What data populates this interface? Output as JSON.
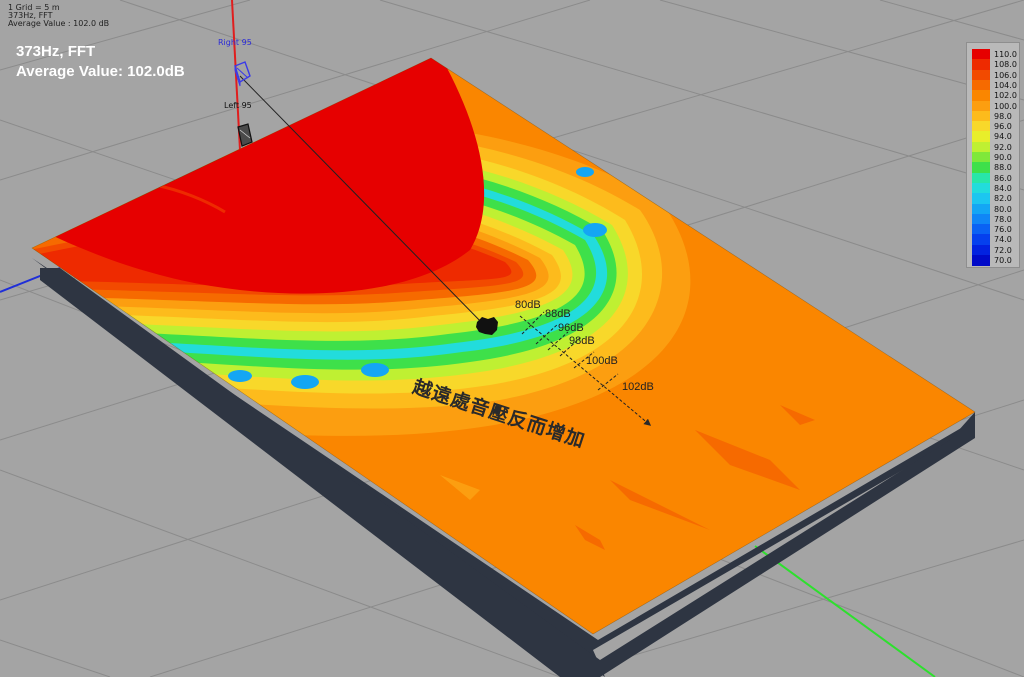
{
  "info": {
    "grid": "1 Grid = 5 m",
    "mode": "373Hz, FFT",
    "avg_small": "Average Value : 102.0 dB"
  },
  "headline": {
    "line1": "373Hz, FFT",
    "line2": "Average Value: 102.0dB"
  },
  "speakers": {
    "right": "Right 95",
    "left": "Left 95"
  },
  "legend": [
    {
      "label": "110.0",
      "color": "#e60000"
    },
    {
      "label": "108.0",
      "color": "#ee2a00"
    },
    {
      "label": "106.0",
      "color": "#f24a00"
    },
    {
      "label": "104.0",
      "color": "#f66a00"
    },
    {
      "label": "102.0",
      "color": "#fa8600"
    },
    {
      "label": "100.0",
      "color": "#fc9e10"
    },
    {
      "label": "98.0",
      "color": "#fdbb1c"
    },
    {
      "label": "96.0",
      "color": "#f8d82a"
    },
    {
      "label": "94.0",
      "color": "#e8ee2a"
    },
    {
      "label": "92.0",
      "color": "#bff032"
    },
    {
      "label": "90.0",
      "color": "#7fe83a"
    },
    {
      "label": "88.0",
      "color": "#3ee04a"
    },
    {
      "label": "86.0",
      "color": "#28e6a8"
    },
    {
      "label": "84.0",
      "color": "#22dcdc"
    },
    {
      "label": "82.0",
      "color": "#1cc6f0"
    },
    {
      "label": "80.0",
      "color": "#14a6f4"
    },
    {
      "label": "78.0",
      "color": "#1086f6"
    },
    {
      "label": "76.0",
      "color": "#0a62f4"
    },
    {
      "label": "74.0",
      "color": "#0540ee"
    },
    {
      "label": "72.0",
      "color": "#0222e0"
    },
    {
      "label": "70.0",
      "color": "#000ac8"
    }
  ],
  "db_marks": [
    "80dB",
    "88dB",
    "96dB",
    "98dB",
    "100dB",
    "102dB"
  ],
  "annotation": "越遠處音壓反而增加"
}
